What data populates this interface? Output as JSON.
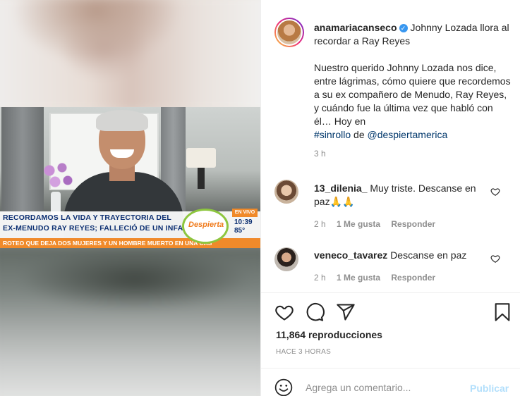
{
  "video": {
    "headline_line1": "RECORDAMOS LA VIDA Y TRAYECTORIA DEL",
    "headline_line2": "EX-MENUDO RAY REYES; FALLECIÓ DE UN INFARTO",
    "ticker": "ROTEO QUE DEJA DOS MUJERES Y UN HOMBRE MUERTO EN UNA CAS",
    "live_label": "EN VIVO",
    "show_logo": "Despierta",
    "time": "10:39",
    "temperature": "85°"
  },
  "post": {
    "username": "anamariacanseco",
    "verified": true,
    "caption_title": "Johnny Lozada llora al recordar a Ray Reyes",
    "caption_body": "Nuestro querido Johnny Lozada nos dice, entre lágrimas, cómo quiere que recordemos a su ex compañero de Menudo, Ray Reyes, y cuándo fue la última vez que habló con él… Hoy en",
    "hashtag": "#sinrollo",
    "connector": "de",
    "mention": "@despiertamerica",
    "age": "3 h"
  },
  "comments": [
    {
      "username": "13_dilenia_",
      "text": "Muy triste. Descanse en paz🙏🙏",
      "age": "2 h",
      "likes": "1 Me gusta",
      "reply": "Responder"
    },
    {
      "username": "veneco_tavarez",
      "text": "Descanse en paz",
      "age": "2 h",
      "likes": "1 Me gusta",
      "reply": "Responder"
    }
  ],
  "stats": {
    "views": "11,864 reproducciones",
    "time_ago": "HACE 3 HORAS"
  },
  "composer": {
    "placeholder": "Agrega un comentario...",
    "publish_label": "Publicar"
  },
  "icons": [
    "heart-icon",
    "comment-icon",
    "share-icon",
    "bookmark-icon",
    "emoji-icon",
    "verified-icon"
  ],
  "colors": {
    "link": "#00376b",
    "verified": "#3897f0",
    "publish_disabled": "#b2dffc",
    "muted": "#8e8e8e"
  }
}
